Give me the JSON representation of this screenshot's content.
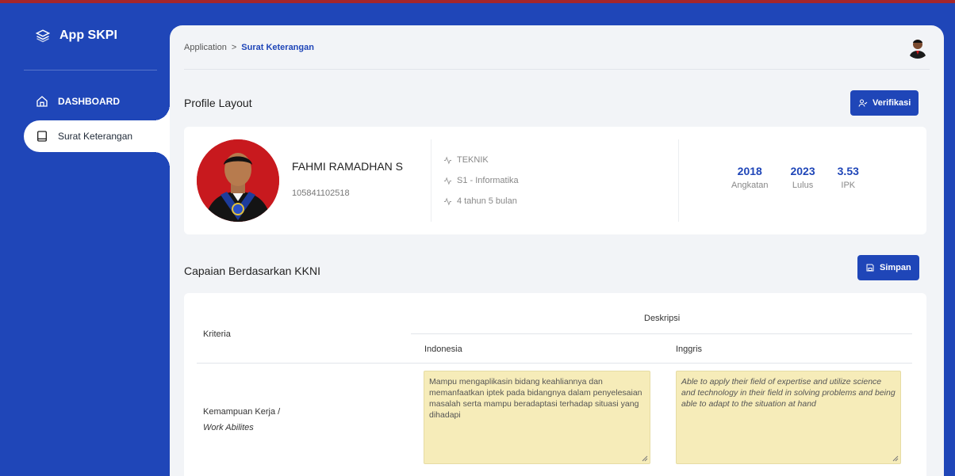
{
  "sidebar": {
    "brand": "App SKPI",
    "items": [
      {
        "label": "DASHBOARD"
      },
      {
        "label": "Surat Keterangan"
      }
    ]
  },
  "breadcrumb": {
    "root": "Application",
    "separator": ">",
    "current": "Surat Keterangan"
  },
  "profile_section": {
    "title": "Profile Layout",
    "verify_button": "Verifikasi"
  },
  "profile": {
    "name": "FAHMI RAMADHAN S",
    "nim": "105841102518",
    "faculty": "TEKNIK",
    "program": "S1 - Informatika",
    "duration": "4 tahun 5 bulan",
    "stats": [
      {
        "value": "2018",
        "label": "Angkatan"
      },
      {
        "value": "2023",
        "label": "Lulus"
      },
      {
        "value": "3.53",
        "label": "IPK"
      }
    ]
  },
  "capaian": {
    "title": "Capaian Berdasarkan KKNI",
    "save_button": "Simpan",
    "header_kriteria": "Kriteria",
    "header_deskripsi": "Deskripsi",
    "header_indonesia": "Indonesia",
    "header_inggris": "Inggris",
    "rows": [
      {
        "criteria": "Kemampuan Kerja /",
        "criteria_en": "Work Abilites",
        "indonesia": "Mampu mengaplikasin bidang keahliannya dan memanfaatkan iptek pada bidangnya dalam penyelesaian masalah serta mampu beradaptasi terhadap situasi yang dihadapi",
        "inggris": "Able to apply their field of expertise and utilize science and technology in their field in solving problems and being able to adapt to the situation at hand"
      }
    ]
  },
  "colors": {
    "primary": "#1f46b8",
    "top_border": "#a5262b",
    "textarea_bg": "#f6ecb9"
  }
}
